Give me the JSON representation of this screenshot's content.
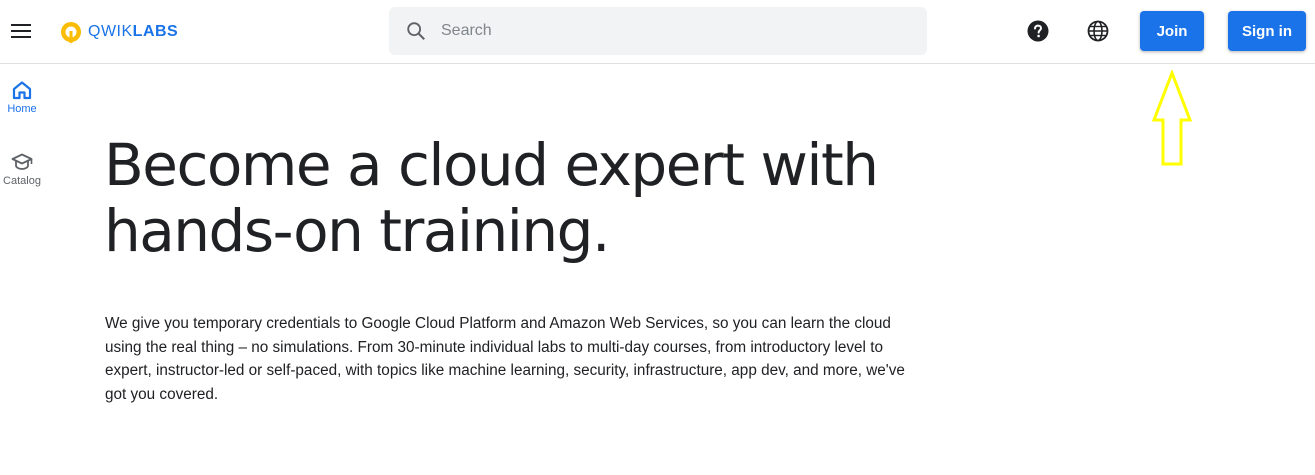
{
  "header": {
    "menu_icon": "hamburger-menu-icon",
    "logo": {
      "prefix": "QWIK",
      "suffix": "LABS",
      "icon": "qwiklabs-logo-icon",
      "color": "#1a73e8",
      "accent": "#fbbc04"
    },
    "search": {
      "placeholder": "Search",
      "value": "",
      "icon": "search-icon"
    },
    "help_icon": "help-circle-icon",
    "language_icon": "globe-icon",
    "join_label": "Join",
    "signin_label": "Sign in"
  },
  "sidebar": {
    "items": [
      {
        "label": "Home",
        "icon": "home-icon",
        "active": true
      },
      {
        "label": "Catalog",
        "icon": "graduation-cap-icon",
        "active": false
      }
    ]
  },
  "main": {
    "headline_line1": "Become a cloud expert with",
    "headline_line2": "hands-on training.",
    "description": "We give you temporary credentials to Google Cloud Platform and Amazon Web Services, so you can learn the cloud using the real thing – no simulations. From 30-minute individual labs to multi-day courses, from introductory level to expert, instructor-led or self-paced, with topics like machine learning, security, infrastructure, app dev, and more, we've got you covered."
  },
  "annotation": {
    "arrow_icon": "up-arrow-annotation-icon",
    "color": "#ffff00"
  },
  "colors": {
    "primary": "#1a73e8",
    "text": "#202124",
    "search_bg": "#f1f3f4"
  }
}
